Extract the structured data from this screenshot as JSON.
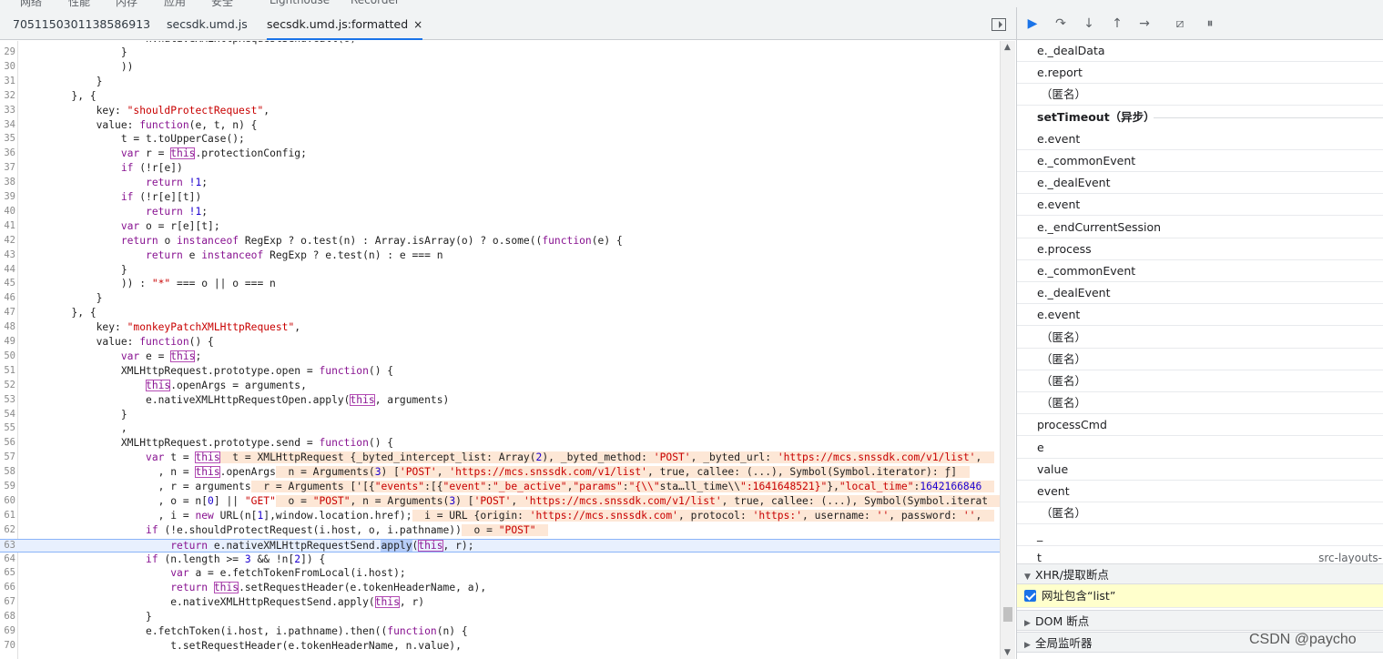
{
  "top_menu": {
    "items": [
      "网络",
      "性能",
      "内存",
      "应用",
      "安全",
      "Lighthouse",
      "Recorder"
    ]
  },
  "tabs": [
    {
      "label": "7051150301138586913"
    },
    {
      "label": "secsdk.umd.js"
    },
    {
      "label": "secsdk.umd.js:formatted",
      "close": "×"
    }
  ],
  "code_lines": [
    {
      "ln": "29",
      "text": "                }"
    },
    {
      "ln": "30",
      "text": "                ))"
    },
    {
      "ln": "31",
      "text": "            }"
    },
    {
      "ln": "32",
      "text": "        }, {"
    },
    {
      "ln": "33",
      "text": "            key: \"shouldProtectRequest\","
    },
    {
      "ln": "34",
      "text": "            value: function(e, t, n) {"
    },
    {
      "ln": "35",
      "text": "                t = t.toUpperCase();"
    },
    {
      "ln": "36",
      "text": "                var r = this.protectionConfig;"
    },
    {
      "ln": "37",
      "text": "                if (!r[e])"
    },
    {
      "ln": "38",
      "text": "                    return !1;"
    },
    {
      "ln": "39",
      "text": "                if (!r[e][t])"
    },
    {
      "ln": "40",
      "text": "                    return !1;"
    },
    {
      "ln": "41",
      "text": "                var o = r[e][t];"
    },
    {
      "ln": "42",
      "text": "                return o instanceof RegExp ? o.test(n) : Array.isArray(o) ? o.some((function(e) {"
    },
    {
      "ln": "43",
      "text": "                    return e instanceof RegExp ? e.test(n) : e === n"
    },
    {
      "ln": "44",
      "text": "                }"
    },
    {
      "ln": "45",
      "text": "                )) : \"*\" === o || o === n"
    },
    {
      "ln": "46",
      "text": "            }"
    },
    {
      "ln": "47",
      "text": "        }, {"
    },
    {
      "ln": "48",
      "text": "            key: \"monkeyPatchXMLHttpRequest\","
    },
    {
      "ln": "49",
      "text": "            value: function() {"
    },
    {
      "ln": "50",
      "text": "                var e = this;"
    },
    {
      "ln": "51",
      "text": "                XMLHttpRequest.prototype.open = function() {"
    },
    {
      "ln": "52",
      "text": "                    this.openArgs = arguments,"
    },
    {
      "ln": "53",
      "text": "                    e.nativeXMLHttpRequestOpen.apply(this, arguments)"
    },
    {
      "ln": "54",
      "text": "                }"
    },
    {
      "ln": "55",
      "text": "                ,"
    },
    {
      "ln": "56",
      "text": "                XMLHttpRequest.prototype.send = function() {"
    },
    {
      "ln": "57",
      "text": "                    var t = this",
      "inline": "t = XMLHttpRequest {_byted_intercept_list: Array(2), _byted_method: 'POST', _byted_url: 'https://mcs.snssdk.com/v1/list',"
    },
    {
      "ln": "58",
      "text": "                      , n = this.openArgs",
      "inline": "n = Arguments(3) ['POST', 'https://mcs.snssdk.com/v1/list', true, callee: (...), Symbol(Symbol.iterator): ƒ]"
    },
    {
      "ln": "59",
      "text": "                      , r = arguments",
      "inline": "r = Arguments ['[{\"events\":[{\"event\":\"_be_active\",\"params\":\"{\\\\\"sta…ll_time\\\\\":1641648521}\"},\"local_time\":1642166846"
    },
    {
      "ln": "60",
      "text": "                      , o = n[0] || \"GET\"",
      "inline": "o = \"POST\", n = Arguments(3) ['POST', 'https://mcs.snssdk.com/v1/list', true, callee: (...), Symbol(Symbol.iterat"
    },
    {
      "ln": "61",
      "text": "                      , i = new URL(n[1],window.location.href);",
      "inline": "i = URL {origin: 'https://mcs.snssdk.com', protocol: 'https:', username: '', password: '',"
    },
    {
      "ln": "62",
      "text": "                    if (!e.shouldProtectRequest(i.host, o, i.pathname))",
      "inline": "o = \"POST\""
    },
    {
      "ln": "63",
      "text": "                        return e.nativeXMLHttpRequestSend.apply(this, r);",
      "exec": true
    },
    {
      "ln": "64",
      "text": "                    if (n.length >= 3 && !n[2]) {"
    },
    {
      "ln": "65",
      "text": "                        var a = e.fetchTokenFromLocal(i.host);"
    },
    {
      "ln": "66",
      "text": "                        return this.setRequestHeader(e.tokenHeaderName, a),"
    },
    {
      "ln": "67",
      "text": "                        e.nativeXMLHttpRequestSend.apply(this, r)"
    },
    {
      "ln": "68",
      "text": "                    }"
    },
    {
      "ln": "69",
      "text": "                    e.fetchToken(i.host, i.pathname).then((function(n) {"
    },
    {
      "ln": "70",
      "text": "                        t.setRequestHeader(e.tokenHeaderName, n.value),"
    }
  ],
  "first_line_partial": "                    n.nativeXMLHttpRequestSend.call(o)",
  "debugger_buttons": [
    "resume-icon",
    "step-over-icon",
    "step-into-icon",
    "step-out-icon",
    "step-icon",
    "deactivate-breakpoints-icon",
    "pause-on-exceptions-icon"
  ],
  "call_stack": [
    {
      "label": "e._dealData"
    },
    {
      "label": "e.report"
    },
    {
      "label": "（匿名）",
      "anon": true
    },
    {
      "async": true,
      "label": "setTimeout（异步）"
    },
    {
      "label": "e.event"
    },
    {
      "label": "e._commonEvent"
    },
    {
      "label": "e._dealEvent"
    },
    {
      "label": "e.event"
    },
    {
      "label": "e._endCurrentSession"
    },
    {
      "label": "e.process"
    },
    {
      "label": "e._commonEvent"
    },
    {
      "label": "e._dealEvent"
    },
    {
      "label": "e.event"
    },
    {
      "label": "（匿名）",
      "anon": true
    },
    {
      "label": "（匿名）",
      "anon": true
    },
    {
      "label": "（匿名）",
      "anon": true
    },
    {
      "label": "（匿名）",
      "anon": true
    },
    {
      "label": "processCmd"
    },
    {
      "label": "e"
    },
    {
      "label": "value"
    },
    {
      "label": "event"
    },
    {
      "label": "（匿名）",
      "anon": true
    },
    {
      "label": "_"
    },
    {
      "label": "t",
      "loc": "src-layouts-"
    }
  ],
  "sections": {
    "xhr": "XHR/提取断点",
    "xhr_rule": "网址包含“list”",
    "dom": "DOM 断点",
    "global": "全局监听器"
  },
  "watermark": "CSDN @paycho",
  "colors": {
    "accent": "#1a73e8",
    "exec_line": "#e8f0fe",
    "inline_value": "#fde7d6",
    "breakpoint_row": "#ffffcc"
  }
}
